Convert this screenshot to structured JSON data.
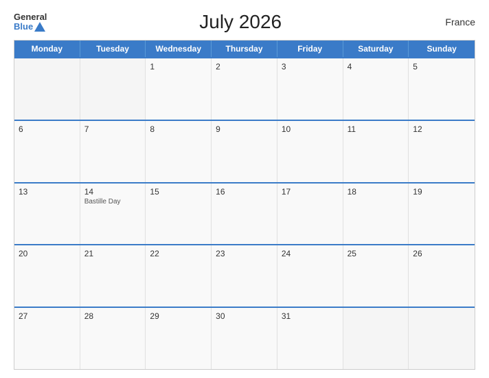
{
  "header": {
    "logo_general": "General",
    "logo_blue": "Blue",
    "title": "July 2026",
    "country": "France"
  },
  "weekdays": [
    "Monday",
    "Tuesday",
    "Wednesday",
    "Thursday",
    "Friday",
    "Saturday",
    "Sunday"
  ],
  "rows": [
    [
      {
        "day": "",
        "empty": true
      },
      {
        "day": "",
        "empty": true
      },
      {
        "day": "1",
        "empty": false
      },
      {
        "day": "2",
        "empty": false
      },
      {
        "day": "3",
        "empty": false
      },
      {
        "day": "4",
        "empty": false
      },
      {
        "day": "5",
        "empty": false
      }
    ],
    [
      {
        "day": "6",
        "empty": false
      },
      {
        "day": "7",
        "empty": false
      },
      {
        "day": "8",
        "empty": false
      },
      {
        "day": "9",
        "empty": false
      },
      {
        "day": "10",
        "empty": false
      },
      {
        "day": "11",
        "empty": false
      },
      {
        "day": "12",
        "empty": false
      }
    ],
    [
      {
        "day": "13",
        "empty": false
      },
      {
        "day": "14",
        "empty": false,
        "holiday": "Bastille Day"
      },
      {
        "day": "15",
        "empty": false
      },
      {
        "day": "16",
        "empty": false
      },
      {
        "day": "17",
        "empty": false
      },
      {
        "day": "18",
        "empty": false
      },
      {
        "day": "19",
        "empty": false
      }
    ],
    [
      {
        "day": "20",
        "empty": false
      },
      {
        "day": "21",
        "empty": false
      },
      {
        "day": "22",
        "empty": false
      },
      {
        "day": "23",
        "empty": false
      },
      {
        "day": "24",
        "empty": false
      },
      {
        "day": "25",
        "empty": false
      },
      {
        "day": "26",
        "empty": false
      }
    ],
    [
      {
        "day": "27",
        "empty": false
      },
      {
        "day": "28",
        "empty": false
      },
      {
        "day": "29",
        "empty": false
      },
      {
        "day": "30",
        "empty": false
      },
      {
        "day": "31",
        "empty": false
      },
      {
        "day": "",
        "empty": true
      },
      {
        "day": "",
        "empty": true
      }
    ]
  ]
}
